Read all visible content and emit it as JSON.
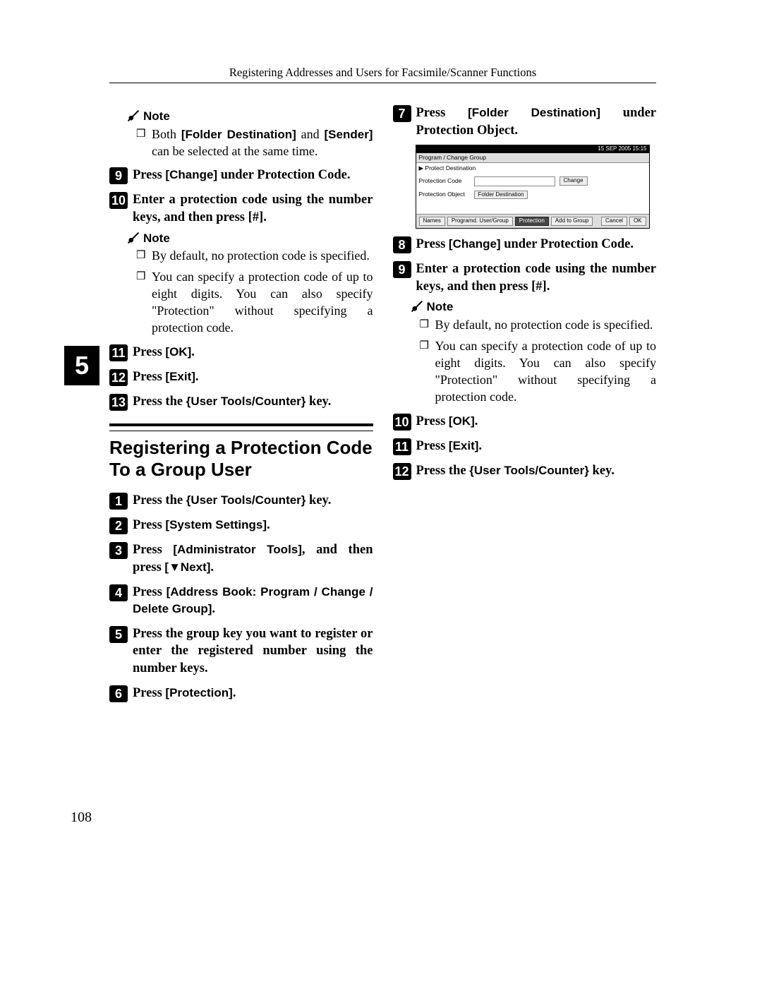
{
  "header": "Registering Addresses and Users for Facsimile/Scanner Functions",
  "chapter_tab": "5",
  "page_number": "108",
  "left": {
    "note1_label": "Note",
    "note1_item": {
      "pre": "Both ",
      "ui1": "[Folder Destination]",
      "mid": " and ",
      "ui2": "[Sender]",
      "post": " can be selected at the same time."
    },
    "step9": {
      "num": "9",
      "pre": "Press ",
      "ui": "[Change]",
      "post": " under Protection Code."
    },
    "step10": {
      "num": "10",
      "text": "Enter a protection code using the number keys, and then press [#]."
    },
    "note2_label": "Note",
    "note2_items": [
      "By default, no protection code is specified.",
      "You can specify a protection code of up to eight digits. You can also specify \"Protection\" without specifying a protection code."
    ],
    "step11": {
      "num": "11",
      "pre": "Press ",
      "ui": "[OK]",
      "post": "."
    },
    "step12": {
      "num": "12",
      "pre": "Press ",
      "ui": "[Exit]",
      "post": "."
    },
    "step13": {
      "num": "13",
      "pre": "Press the ",
      "key": "{User Tools/Counter}",
      "post": " key."
    },
    "h2": "Registering a Protection Code To a Group User",
    "g_step1": {
      "num": "1",
      "pre": "Press the ",
      "key": "{User Tools/Counter}",
      "post": " key."
    },
    "g_step2": {
      "num": "2",
      "pre": "Press ",
      "ui": "[System Settings]",
      "post": "."
    },
    "g_step3": {
      "num": "3",
      "pre": "Press ",
      "ui": "[Administrator Tools]",
      "mid": ", and then press ",
      "ui2": "[▼Next]",
      "post": "."
    },
    "g_step4": {
      "num": "4",
      "pre": "Press ",
      "ui": "[Address Book: Program / Change / Delete Group]",
      "post": "."
    },
    "g_step5": {
      "num": "5",
      "text": "Press the group key you want to register or enter the registered number using the number keys."
    },
    "g_step6": {
      "num": "6",
      "pre": "Press ",
      "ui": "[Protection]",
      "post": "."
    }
  },
  "right": {
    "step7": {
      "num": "7",
      "pre": "Press ",
      "ui": "[Folder Destination]",
      "post": " under Protection Object."
    },
    "shot": {
      "clock": "15  SEP   2005  15:15",
      "caption": "Program / Change Group",
      "crumb": "▶ Protect Destination",
      "row1_label": "Protection Code",
      "row1_btn": "Change",
      "row2_label": "Protection Object",
      "row2_btn": "Folder Destination",
      "tabs": [
        "Names",
        "Programd. User/Group",
        "Protection",
        "Add to Group"
      ],
      "cancel": "Cancel",
      "ok": "OK"
    },
    "step8": {
      "num": "8",
      "pre": "Press ",
      "ui": "[Change]",
      "post": " under Protection Code."
    },
    "step9": {
      "num": "9",
      "text": "Enter a protection code using the number keys, and then press [#]."
    },
    "note_label": "Note",
    "note_items": [
      "By default, no protection code is specified.",
      "You can specify a protection code of up to eight digits. You can also specify \"Protection\" without specifying a protection code."
    ],
    "step10": {
      "num": "10",
      "pre": "Press ",
      "ui": "[OK]",
      "post": "."
    },
    "step11": {
      "num": "11",
      "pre": "Press ",
      "ui": "[Exit]",
      "post": "."
    },
    "step12": {
      "num": "12",
      "pre": "Press the ",
      "key": "{User Tools/Counter}",
      "post": " key."
    }
  }
}
